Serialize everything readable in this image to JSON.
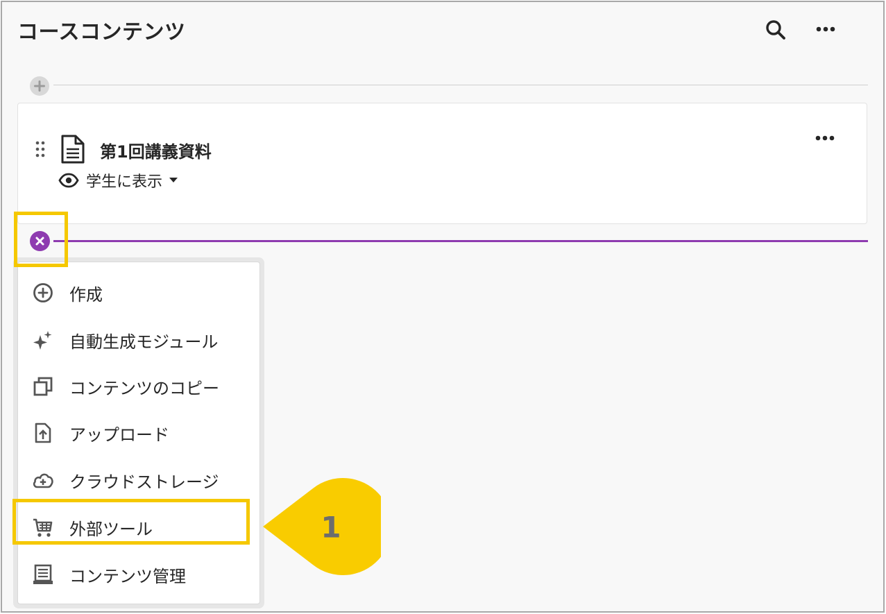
{
  "header": {
    "title": "コースコンテンツ",
    "search_icon": "search-icon",
    "more_icon": "more-horizontal-icon"
  },
  "content_item": {
    "title": "第1回講義資料",
    "icon": "document-icon",
    "visibility_label": "学生に表示",
    "visibility_icon": "eye-icon"
  },
  "add_menu": {
    "items": [
      {
        "label": "作成",
        "icon": "plus-circle-icon"
      },
      {
        "label": "自動生成モジュール",
        "icon": "sparkle-icon"
      },
      {
        "label": "コンテンツのコピー",
        "icon": "copy-icon"
      },
      {
        "label": "アップロード",
        "icon": "upload-icon"
      },
      {
        "label": "クラウドストレージ",
        "icon": "cloud-add-icon"
      },
      {
        "label": "外部ツール",
        "icon": "cart-icon"
      },
      {
        "label": "コンテンツ管理",
        "icon": "content-manage-icon"
      }
    ]
  },
  "annotation": {
    "callout_number": "1"
  },
  "colors": {
    "accent_purple": "#8e3bb0",
    "highlight_yellow": "#f5c800",
    "callout_yellow": "#f9cc00",
    "background": "#f8f8f8"
  }
}
